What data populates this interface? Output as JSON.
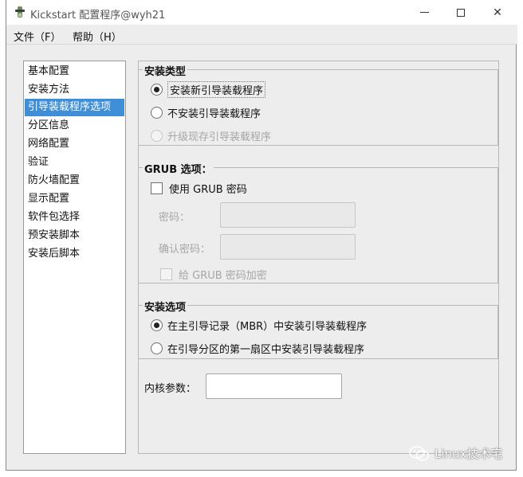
{
  "window": {
    "title": "Kickstart 配置程序@wyh21",
    "minimize_symbol": "",
    "close_symbol": "✕"
  },
  "menu": {
    "file": "文件（F）",
    "help": "帮助（H）"
  },
  "sidebar": {
    "items": [
      {
        "label": "基本配置"
      },
      {
        "label": "安装方法"
      },
      {
        "label": "引导装载程序选项"
      },
      {
        "label": "分区信息"
      },
      {
        "label": "网络配置"
      },
      {
        "label": "验证"
      },
      {
        "label": "防火墙配置"
      },
      {
        "label": "显示配置"
      },
      {
        "label": "软件包选择"
      },
      {
        "label": "预安装脚本"
      },
      {
        "label": "安装后脚本"
      }
    ],
    "selected_index": 2
  },
  "install_type": {
    "title": "安装类型",
    "options": [
      {
        "label": "安装新引导装载程序",
        "checked": true
      },
      {
        "label": "不安装引导装载程序",
        "checked": false
      },
      {
        "label": "升级现存引导装载程序",
        "checked": false,
        "disabled": true
      }
    ]
  },
  "grub": {
    "title": "GRUB 选项：",
    "use_password_label": "使用  GRUB 密码",
    "password_label": "密码：",
    "password_value": "",
    "confirm_label": "确认密码：",
    "confirm_value": "",
    "encrypt_label": "给  GRUB 密码加密"
  },
  "install_options": {
    "title": "安装选项",
    "options": [
      {
        "label": "在主引导记录（MBR）中安装引导装载程序",
        "checked": true
      },
      {
        "label": "在引导分区的第一扇区中安装引导装载程序",
        "checked": false
      }
    ]
  },
  "kernel": {
    "label": "内核参数：",
    "value": ""
  },
  "watermark": {
    "text": "Linux技术宅",
    "icon": "wechat-icon"
  },
  "colors": {
    "selection": "#3f8fd8",
    "window_bg": "#ededed",
    "disabled_text": "#a6a6a6"
  }
}
